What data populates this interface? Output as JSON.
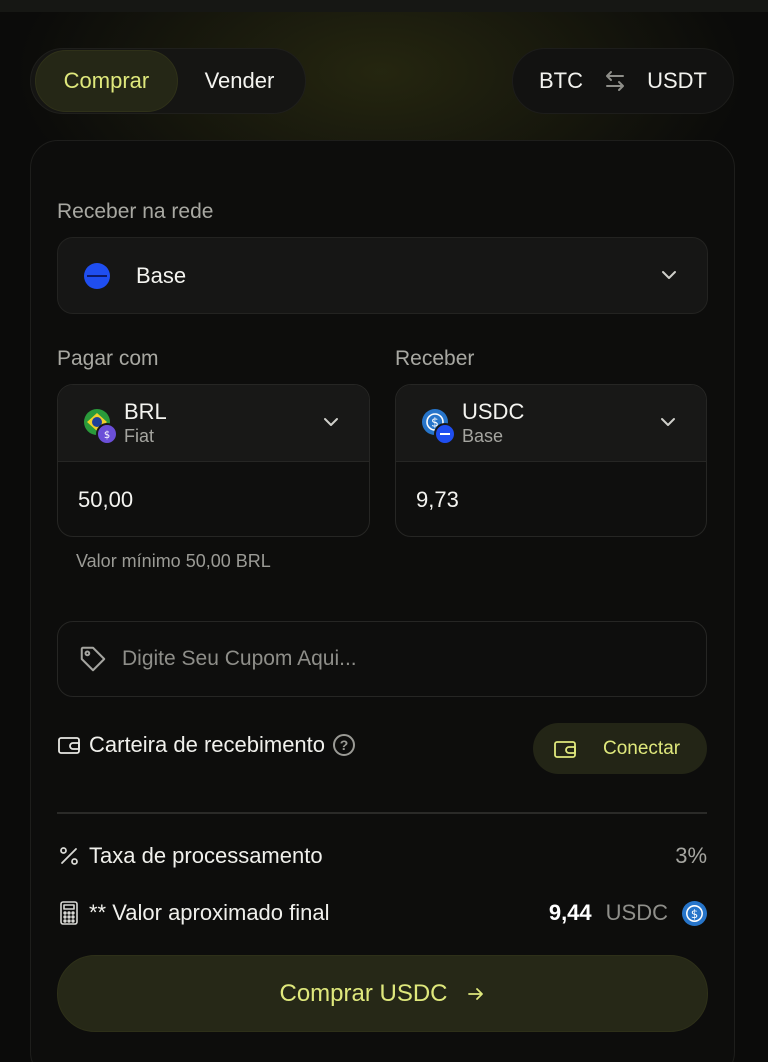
{
  "mode_tabs": {
    "buy": "Comprar",
    "sell": "Vender"
  },
  "pair": {
    "left": "BTC",
    "right": "USDT",
    "swap_icon": "swap-arrows-icon"
  },
  "network": {
    "label": "Receber na rede",
    "value": "Base"
  },
  "pay": {
    "label": "Pagar com",
    "currency": "BRL",
    "type": "Fiat",
    "amount": "50,00"
  },
  "receive": {
    "label": "Receber",
    "currency": "USDC",
    "network": "Base",
    "amount": "9,73"
  },
  "min_note": "Valor mínimo 50,00 BRL",
  "coupon": {
    "placeholder": "Digite Seu Cupom Aqui..."
  },
  "wallet": {
    "label": "Carteira de recebimento",
    "help": "?",
    "connect_label": "Conectar"
  },
  "fee": {
    "label": "Taxa de processamento",
    "value": "3%"
  },
  "final": {
    "label": "** Valor aproximado final",
    "amount": "9,44",
    "currency": "USDC"
  },
  "cta": {
    "label": "Comprar USDC"
  },
  "colors": {
    "accent": "#dfe87c",
    "base_blue": "#1f4ef0",
    "usdc_blue": "#2775ca"
  }
}
